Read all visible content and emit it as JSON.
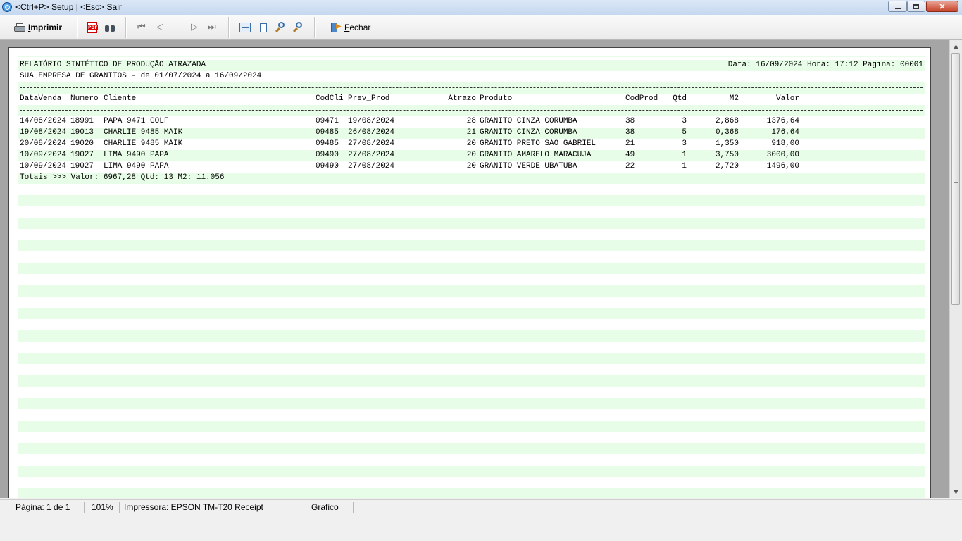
{
  "window": {
    "title": "<Ctrl+P> Setup | <Esc> Sair"
  },
  "toolbar": {
    "print_label": "Imprimir",
    "close_label": "Fechar"
  },
  "report": {
    "title": "RELATÓRIO SINTÉTICO DE PRODUÇÃO ATRAZADA",
    "subtitle": "SUA EMPRESA DE GRANITOS - de 01/07/2024 a 16/09/2024",
    "header_info": "Data: 16/09/2024 Hora: 17:12 Pagina: 00001",
    "columns": {
      "data_venda": "DataVenda",
      "numero": "Numero",
      "cliente": "Cliente",
      "codcli": "CodCli",
      "prev_prod": "Prev_Prod",
      "atrazo": "Atrazo",
      "produto": "Produto",
      "codprod": "CodProd",
      "qtd": "Qtd",
      "m2": "M2",
      "valor": "Valor"
    },
    "rows": [
      {
        "data_venda": "14/08/2024",
        "numero": "18991",
        "cliente": "PAPA 9471 GOLF",
        "codcli": "09471",
        "prev_prod": "19/08/2024",
        "atrazo": "28",
        "produto": "GRANITO CINZA CORUMBA",
        "codprod": "38",
        "qtd": "3",
        "m2": "2,868",
        "valor": "1376,64"
      },
      {
        "data_venda": "19/08/2024",
        "numero": "19013",
        "cliente": "CHARLIE 9485 MAIK",
        "codcli": "09485",
        "prev_prod": "26/08/2024",
        "atrazo": "21",
        "produto": "GRANITO CINZA CORUMBA",
        "codprod": "38",
        "qtd": "5",
        "m2": "0,368",
        "valor": "176,64"
      },
      {
        "data_venda": "20/08/2024",
        "numero": "19020",
        "cliente": "CHARLIE 9485 MAIK",
        "codcli": "09485",
        "prev_prod": "27/08/2024",
        "atrazo": "20",
        "produto": "GRANITO PRETO SAO GABRIEL",
        "codprod": "21",
        "qtd": "3",
        "m2": "1,350",
        "valor": "918,00"
      },
      {
        "data_venda": "10/09/2024",
        "numero": "19027",
        "cliente": "LIMA 9490 PAPA",
        "codcli": "09490",
        "prev_prod": "27/08/2024",
        "atrazo": "20",
        "produto": "GRANITO AMARELO MARACUJA",
        "codprod": "49",
        "qtd": "1",
        "m2": "3,750",
        "valor": "3000,00"
      },
      {
        "data_venda": "10/09/2024",
        "numero": "19027",
        "cliente": "LIMA 9490 PAPA",
        "codcli": "09490",
        "prev_prod": "27/08/2024",
        "atrazo": "20",
        "produto": "GRANITO VERDE UBATUBA",
        "codprod": "22",
        "qtd": "1",
        "m2": "2,720",
        "valor": "1496,00"
      }
    ],
    "totals": "Totais >>> Valor: 6967,28 Qtd: 13 M2: 11.056",
    "rule_text": "------------------------------------------------------------------------------------------------------------------------------------------------------------------------------"
  },
  "statusbar": {
    "page": "Página: 1 de 1",
    "zoom": "101%",
    "printer": "Impressora: EPSON TM-T20 Receipt",
    "mode": "Grafico"
  },
  "colors": {
    "stripe": "#e8fde8",
    "preview_background": "#a5a5a5"
  }
}
